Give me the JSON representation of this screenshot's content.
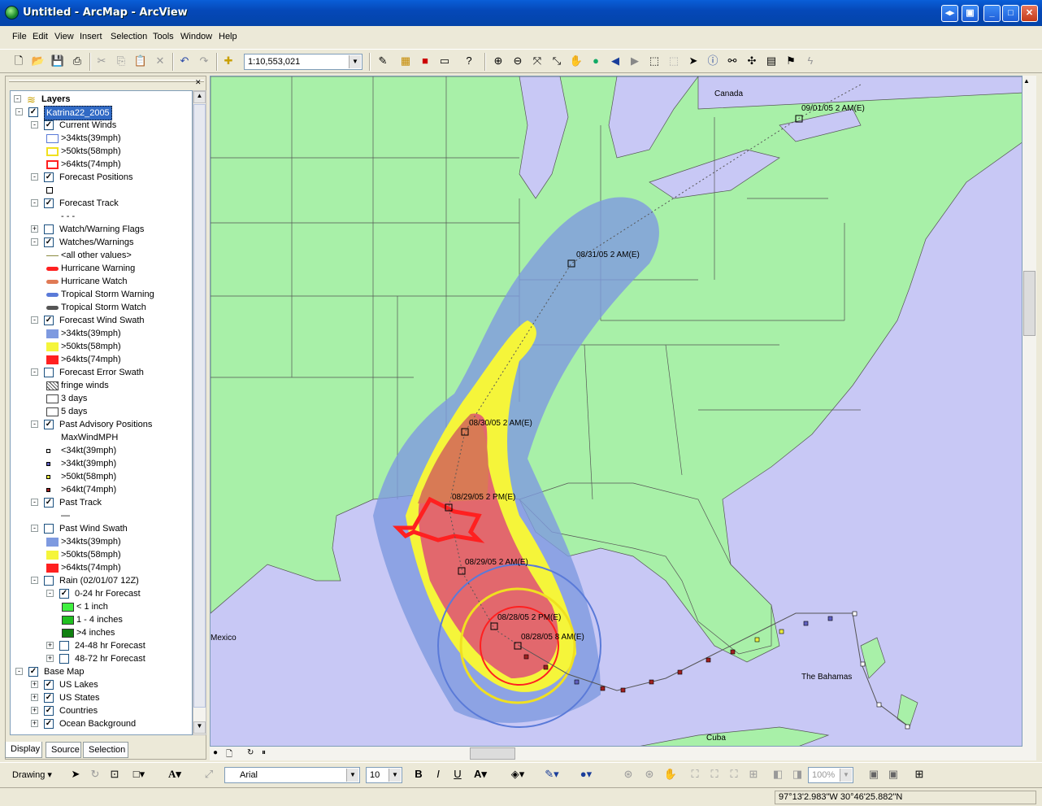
{
  "window": {
    "title": "Untitled - ArcMap - ArcView"
  },
  "menu": [
    "File",
    "Edit",
    "View",
    "Insert",
    "Selection",
    "Tools",
    "Window",
    "Help"
  ],
  "toolbar": {
    "scale": "1:10,553,021"
  },
  "toc": {
    "root": "Layers",
    "rows": [
      {
        "label": "Katrina22_2005",
        "indent": 1,
        "cb": "checked",
        "exp": "-",
        "sel": true
      },
      {
        "label": "Current Winds",
        "indent": 2,
        "cb": "checked",
        "exp": "-"
      },
      {
        "label": ">34kts(39mph)",
        "indent": 3,
        "sw": "box-blue"
      },
      {
        "label": ">50kts(58mph)",
        "indent": 3,
        "sw": "box-yellow"
      },
      {
        "label": ">64kts(74mph)",
        "indent": 3,
        "sw": "box-red"
      },
      {
        "label": "Forecast Positions",
        "indent": 2,
        "cb": "checked",
        "exp": "-"
      },
      {
        "label": "",
        "indent": 3,
        "sw": "sq-small"
      },
      {
        "label": "Forecast Track",
        "indent": 2,
        "cb": "checked",
        "exp": "-"
      },
      {
        "label": "- - -",
        "indent": 3,
        "sw": "none"
      },
      {
        "label": "Watch/Warning Flags",
        "indent": 2,
        "cb": "unchecked",
        "exp": "+"
      },
      {
        "label": "Watches/Warnings",
        "indent": 2,
        "cb": "checked",
        "exp": "-"
      },
      {
        "label": "<all other values>",
        "indent": 3,
        "sw": "line-olive"
      },
      {
        "label": "Hurricane Warning",
        "indent": 3,
        "sw": "line-red"
      },
      {
        "label": "Hurricane Watch",
        "indent": 3,
        "sw": "line-salmon"
      },
      {
        "label": "Tropical Storm Warning",
        "indent": 3,
        "sw": "line-blue"
      },
      {
        "label": "Tropical Storm Watch",
        "indent": 3,
        "sw": "line-gray"
      },
      {
        "label": "Forecast Wind Swath",
        "indent": 2,
        "cb": "checked",
        "exp": "-"
      },
      {
        "label": ">34kts(39mph)",
        "indent": 3,
        "sw": "fill-blue"
      },
      {
        "label": ">50kts(58mph)",
        "indent": 3,
        "sw": "fill-yellow"
      },
      {
        "label": ">64kts(74mph)",
        "indent": 3,
        "sw": "fill-red"
      },
      {
        "label": "Forecast Error Swath",
        "indent": 2,
        "cb": "unchecked",
        "exp": "-"
      },
      {
        "label": "fringe winds",
        "indent": 3,
        "sw": "hatch"
      },
      {
        "label": "3 days",
        "indent": 3,
        "sw": "box-plain"
      },
      {
        "label": "5 days",
        "indent": 3,
        "sw": "box-plain"
      },
      {
        "label": "Past Advisory Positions",
        "indent": 2,
        "cb": "checked",
        "exp": "-"
      },
      {
        "label": "MaxWindMPH",
        "indent": 3,
        "sw": "none"
      },
      {
        "label": "<34kt(39mph)",
        "indent": 3,
        "sw": "dot-white"
      },
      {
        "label": ">34kt(39mph)",
        "indent": 3,
        "sw": "dot-blue"
      },
      {
        "label": ">50kt(58mph)",
        "indent": 3,
        "sw": "dot-yellow"
      },
      {
        "label": ">64kt(74mph)",
        "indent": 3,
        "sw": "dot-red"
      },
      {
        "label": "Past Track",
        "indent": 2,
        "cb": "checked",
        "exp": "-"
      },
      {
        "label": "—",
        "indent": 3,
        "sw": "none"
      },
      {
        "label": "Past Wind Swath",
        "indent": 2,
        "cb": "unchecked",
        "exp": "-"
      },
      {
        "label": ">34kts(39mph)",
        "indent": 3,
        "sw": "fill-blue"
      },
      {
        "label": ">50kts(58mph)",
        "indent": 3,
        "sw": "fill-yellow"
      },
      {
        "label": ">64kts(74mph)",
        "indent": 3,
        "sw": "fill-red"
      },
      {
        "label": "Rain (02/01/07 12Z)",
        "indent": 2,
        "cb": "unchecked",
        "exp": "-"
      },
      {
        "label": "0-24 hr Forecast",
        "indent": 3,
        "cb": "checked",
        "exp": "-"
      },
      {
        "label": "< 1 inch",
        "indent": 4,
        "sw": "fill-lgreen"
      },
      {
        "label": "1 - 4 inches",
        "indent": 4,
        "sw": "fill-green"
      },
      {
        "label": ">4 inches",
        "indent": 4,
        "sw": "fill-dgreen"
      },
      {
        "label": "24-48 hr Forecast",
        "indent": 3,
        "cb": "unchecked",
        "exp": "+"
      },
      {
        "label": "48-72 hr Forecast",
        "indent": 3,
        "cb": "unchecked",
        "exp": "+"
      },
      {
        "label": "Base Map",
        "indent": 1,
        "cb": "checked",
        "exp": "-"
      },
      {
        "label": "US Lakes",
        "indent": 2,
        "cb": "checked",
        "exp": "+"
      },
      {
        "label": "US States",
        "indent": 2,
        "cb": "checked",
        "exp": "+"
      },
      {
        "label": "Countries",
        "indent": 2,
        "cb": "checked",
        "exp": "+"
      },
      {
        "label": "Ocean Background",
        "indent": 2,
        "cb": "checked",
        "exp": "+"
      }
    ],
    "tabs": [
      "Display",
      "Source",
      "Selection"
    ]
  },
  "map": {
    "labels": {
      "canada": "Canada",
      "mexico": "Mexico",
      "bahamas": "The Bahamas",
      "cuba": "Cuba",
      "p0901": "09/01/05 2 AM(E)",
      "p0831": "08/31/05 2 AM(E)",
      "p0830": "08/30/05 2 AM(E)",
      "p0829pm": "08/29/05 2 PM(E)",
      "p0829am": "08/29/05 2 AM(E)",
      "p0828pm": "08/28/05 2 PM(E)",
      "p0828am": "08/28/05 8 AM(E)"
    }
  },
  "drawing": {
    "label": "Drawing",
    "font": "Arial",
    "size": "10",
    "zoom": "100%"
  },
  "status": {
    "coords": "97°13'2.983\"W  30°46'25.882\"N"
  }
}
